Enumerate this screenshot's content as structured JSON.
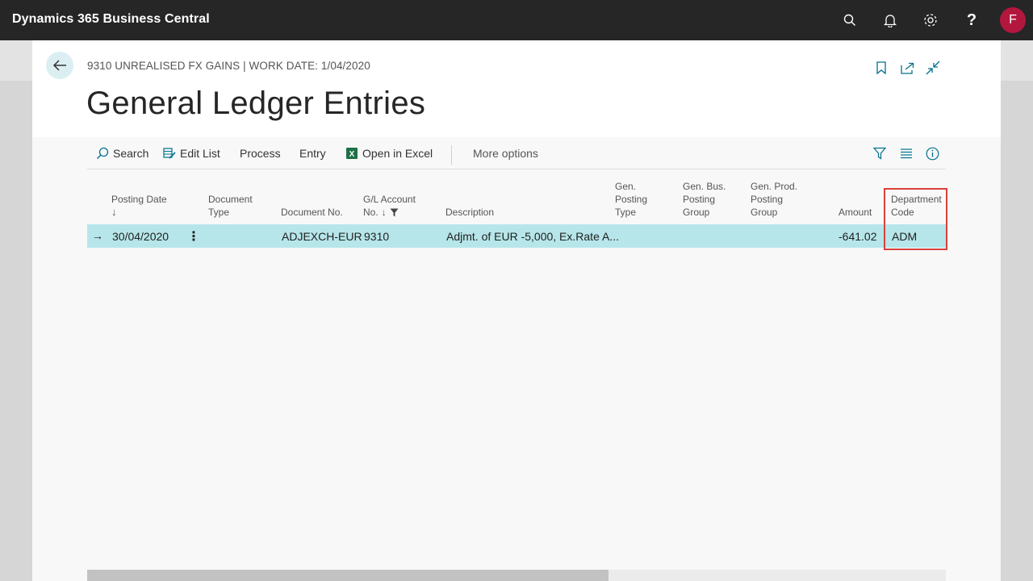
{
  "app": {
    "title": "Dynamics 365 Business Central",
    "avatar_initial": "F",
    "accent": "#b4173e"
  },
  "header": {
    "breadcrumb": "9310 UNREALISED FX GAINS | WORK DATE: 1/04/2020",
    "title": "General Ledger Entries"
  },
  "actions": {
    "search": "Search",
    "edit_list": "Edit List",
    "process": "Process",
    "entry": "Entry",
    "open_in_excel": "Open in Excel",
    "more_options": "More options"
  },
  "columns": {
    "posting_date": "Posting Date",
    "document_type_1": "Document",
    "document_type_2": "Type",
    "document_no": "Document No.",
    "gl_account_1": "G/L Account",
    "gl_account_2": "No.",
    "description": "Description",
    "gen_posting_type_1": "Gen.",
    "gen_posting_type_2": "Posting",
    "gen_posting_type_3": "Type",
    "gen_bus_1": "Gen. Bus.",
    "gen_bus_2": "Posting",
    "gen_bus_3": "Group",
    "gen_prod_1": "Gen. Prod.",
    "gen_prod_2": "Posting",
    "gen_prod_3": "Group",
    "amount": "Amount",
    "department_1": "Department",
    "department_2": "Code"
  },
  "rows": [
    {
      "posting_date": "30/04/2020",
      "document_type": "",
      "document_no": "ADJEXCH-EUR",
      "gl_account_no": "9310",
      "description": "Adjmt. of EUR -5,000, Ex.Rate A...",
      "gen_posting_type": "",
      "gen_bus_posting_group": "",
      "gen_prod_posting_group": "",
      "amount": "-641.02",
      "department_code": "ADM"
    }
  ],
  "colors": {
    "selected_row": "#b6e6ea",
    "highlight": "#d9413a",
    "topbar": "#262626"
  }
}
